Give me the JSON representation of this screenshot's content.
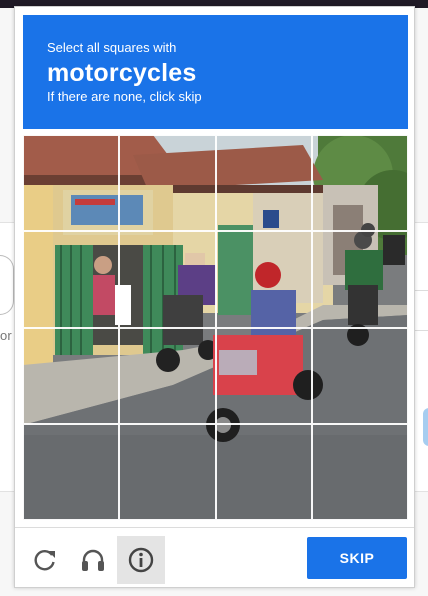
{
  "background": {
    "partial_text": "or"
  },
  "captcha": {
    "header": {
      "pre": "Select all squares with",
      "main": "motorcycles",
      "post": "If there are none, click skip"
    },
    "grid": {
      "rows": 4,
      "cols": 4,
      "image_description_icon": "street-scene-image"
    },
    "footer": {
      "reload_icon": "reload-icon",
      "audio_icon": "headphones-icon",
      "info_icon": "info-icon",
      "skip_label": "SKIP"
    }
  },
  "colors": {
    "accent": "#1a73e8",
    "frame_border": "#cfcfcf",
    "info_bg": "#e4e4e4"
  }
}
